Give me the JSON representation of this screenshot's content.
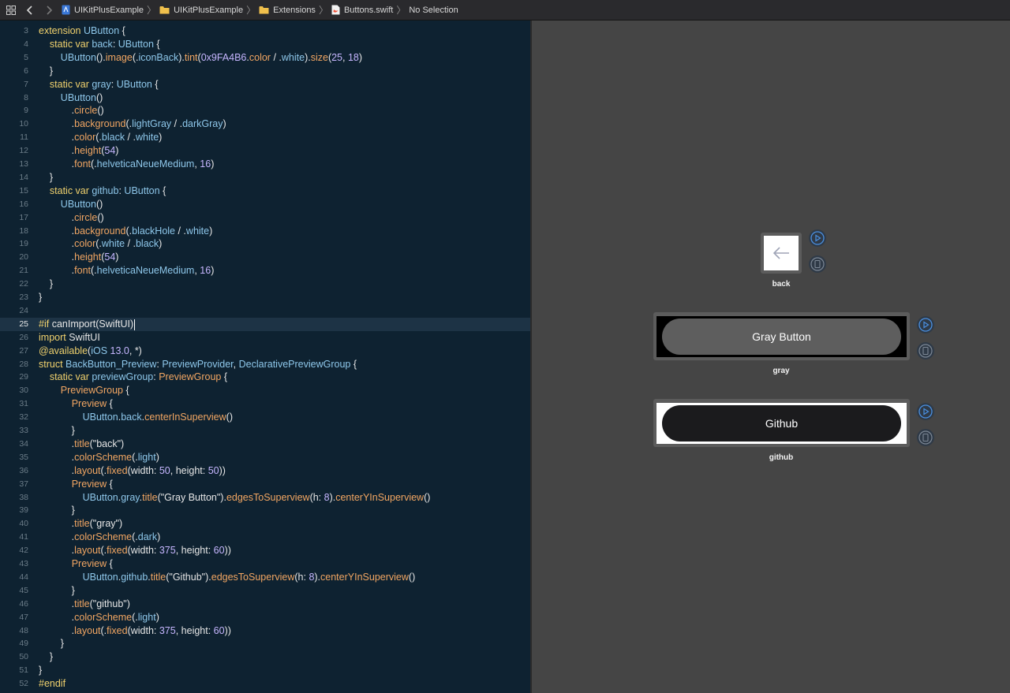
{
  "breadcrumb": {
    "items": [
      {
        "label": "UIKitPlusExample",
        "icon": "project-file-icon"
      },
      {
        "label": "UIKitPlusExample",
        "icon": "folder-icon"
      },
      {
        "label": "Extensions",
        "icon": "folder-icon"
      },
      {
        "label": "Buttons.swift",
        "icon": "swift-file-icon"
      },
      {
        "label": "No Selection",
        "icon": ""
      }
    ]
  },
  "editor": {
    "current_line": 25,
    "lines": [
      {
        "n": "3",
        "tokens": [
          [
            "kw",
            "extension "
          ],
          [
            "ty",
            "UButton"
          ],
          [
            "pl",
            " {"
          ]
        ]
      },
      {
        "n": "4",
        "tokens": [
          [
            "pl",
            "    "
          ],
          [
            "kw",
            "static var "
          ],
          [
            "ty",
            "back"
          ],
          [
            "pl",
            ": "
          ],
          [
            "ty",
            "UButton"
          ],
          [
            "pl",
            " {"
          ]
        ]
      },
      {
        "n": "5",
        "tokens": [
          [
            "pl",
            "        "
          ],
          [
            "ty",
            "UButton"
          ],
          [
            "pl",
            "()."
          ],
          [
            "fn",
            "image"
          ],
          [
            "pl",
            "(."
          ],
          [
            "ty",
            "iconBack"
          ],
          [
            "pl",
            ")."
          ],
          [
            "fn",
            "tint"
          ],
          [
            "pl",
            "("
          ],
          [
            "nm",
            "0x9FA4B6"
          ],
          [
            "pl",
            "."
          ],
          [
            "fn",
            "color"
          ],
          [
            "pl",
            " / ."
          ],
          [
            "ty",
            "white"
          ],
          [
            "pl",
            ")."
          ],
          [
            "fn",
            "size"
          ],
          [
            "pl",
            "("
          ],
          [
            "nm",
            "25"
          ],
          [
            "pl",
            ", "
          ],
          [
            "nm",
            "18"
          ],
          [
            "pl",
            ")"
          ]
        ]
      },
      {
        "n": "6",
        "tokens": [
          [
            "pl",
            "    }"
          ]
        ]
      },
      {
        "n": "7",
        "tokens": [
          [
            "pl",
            "    "
          ],
          [
            "kw",
            "static var "
          ],
          [
            "ty",
            "gray"
          ],
          [
            "pl",
            ": "
          ],
          [
            "ty",
            "UButton"
          ],
          [
            "pl",
            " {"
          ]
        ]
      },
      {
        "n": "8",
        "tokens": [
          [
            "pl",
            "        "
          ],
          [
            "ty",
            "UButton"
          ],
          [
            "pl",
            "()"
          ]
        ]
      },
      {
        "n": "9",
        "tokens": [
          [
            "pl",
            "            ."
          ],
          [
            "fn",
            "circle"
          ],
          [
            "pl",
            "()"
          ]
        ]
      },
      {
        "n": "10",
        "tokens": [
          [
            "pl",
            "            ."
          ],
          [
            "fn",
            "background"
          ],
          [
            "pl",
            "(."
          ],
          [
            "ty",
            "lightGray"
          ],
          [
            "pl",
            " / ."
          ],
          [
            "ty",
            "darkGray"
          ],
          [
            "pl",
            ")"
          ]
        ]
      },
      {
        "n": "11",
        "tokens": [
          [
            "pl",
            "            ."
          ],
          [
            "fn",
            "color"
          ],
          [
            "pl",
            "(."
          ],
          [
            "ty",
            "black"
          ],
          [
            "pl",
            " / ."
          ],
          [
            "ty",
            "white"
          ],
          [
            "pl",
            ")"
          ]
        ]
      },
      {
        "n": "12",
        "tokens": [
          [
            "pl",
            "            ."
          ],
          [
            "fn",
            "height"
          ],
          [
            "pl",
            "("
          ],
          [
            "nm",
            "54"
          ],
          [
            "pl",
            ")"
          ]
        ]
      },
      {
        "n": "13",
        "tokens": [
          [
            "pl",
            "            ."
          ],
          [
            "fn",
            "font"
          ],
          [
            "pl",
            "(."
          ],
          [
            "ty",
            "helveticaNeueMedium"
          ],
          [
            "pl",
            ", "
          ],
          [
            "nm",
            "16"
          ],
          [
            "pl",
            ")"
          ]
        ]
      },
      {
        "n": "14",
        "tokens": [
          [
            "pl",
            "    }"
          ]
        ]
      },
      {
        "n": "15",
        "tokens": [
          [
            "pl",
            "    "
          ],
          [
            "kw",
            "static var "
          ],
          [
            "ty",
            "github"
          ],
          [
            "pl",
            ": "
          ],
          [
            "ty",
            "UButton"
          ],
          [
            "pl",
            " {"
          ]
        ]
      },
      {
        "n": "16",
        "tokens": [
          [
            "pl",
            "        "
          ],
          [
            "ty",
            "UButton"
          ],
          [
            "pl",
            "()"
          ]
        ]
      },
      {
        "n": "17",
        "tokens": [
          [
            "pl",
            "            ."
          ],
          [
            "fn",
            "circle"
          ],
          [
            "pl",
            "()"
          ]
        ]
      },
      {
        "n": "18",
        "tokens": [
          [
            "pl",
            "            ."
          ],
          [
            "fn",
            "background"
          ],
          [
            "pl",
            "(."
          ],
          [
            "ty",
            "blackHole"
          ],
          [
            "pl",
            " / ."
          ],
          [
            "ty",
            "white"
          ],
          [
            "pl",
            ")"
          ]
        ]
      },
      {
        "n": "19",
        "tokens": [
          [
            "pl",
            "            ."
          ],
          [
            "fn",
            "color"
          ],
          [
            "pl",
            "(."
          ],
          [
            "ty",
            "white"
          ],
          [
            "pl",
            " / ."
          ],
          [
            "ty",
            "black"
          ],
          [
            "pl",
            ")"
          ]
        ]
      },
      {
        "n": "20",
        "tokens": [
          [
            "pl",
            "            ."
          ],
          [
            "fn",
            "height"
          ],
          [
            "pl",
            "("
          ],
          [
            "nm",
            "54"
          ],
          [
            "pl",
            ")"
          ]
        ]
      },
      {
        "n": "21",
        "tokens": [
          [
            "pl",
            "            ."
          ],
          [
            "fn",
            "font"
          ],
          [
            "pl",
            "(."
          ],
          [
            "ty",
            "helveticaNeueMedium"
          ],
          [
            "pl",
            ", "
          ],
          [
            "nm",
            "16"
          ],
          [
            "pl",
            ")"
          ]
        ]
      },
      {
        "n": "22",
        "tokens": [
          [
            "pl",
            "    }"
          ]
        ]
      },
      {
        "n": "23",
        "tokens": [
          [
            "pl",
            "}"
          ]
        ]
      },
      {
        "n": "24",
        "tokens": []
      },
      {
        "n": "25",
        "tokens": [
          [
            "pre",
            "#if "
          ],
          [
            "pl",
            "canImport(SwiftUI)"
          ]
        ]
      },
      {
        "n": "26",
        "tokens": [
          [
            "kw",
            "import "
          ],
          [
            "pl",
            "SwiftUI"
          ]
        ]
      },
      {
        "n": "27",
        "tokens": [
          [
            "kw",
            "@available"
          ],
          [
            "pl",
            "("
          ],
          [
            "ty",
            "iOS"
          ],
          [
            "pl",
            " "
          ],
          [
            "nm",
            "13.0"
          ],
          [
            "pl",
            ", *)"
          ]
        ]
      },
      {
        "n": "28",
        "tokens": [
          [
            "kw",
            "struct "
          ],
          [
            "ty",
            "BackButton_Preview"
          ],
          [
            "pl",
            ": "
          ],
          [
            "ty",
            "PreviewProvider"
          ],
          [
            "pl",
            ", "
          ],
          [
            "ty",
            "DeclarativePreviewGroup"
          ],
          [
            "pl",
            " {"
          ]
        ]
      },
      {
        "n": "29",
        "tokens": [
          [
            "pl",
            "    "
          ],
          [
            "kw",
            "static var "
          ],
          [
            "ty",
            "previewGroup"
          ],
          [
            "pl",
            ": "
          ],
          [
            "fn",
            "PreviewGroup"
          ],
          [
            "pl",
            " {"
          ]
        ]
      },
      {
        "n": "30",
        "tokens": [
          [
            "pl",
            "        "
          ],
          [
            "fn",
            "PreviewGroup"
          ],
          [
            "pl",
            " {"
          ]
        ]
      },
      {
        "n": "31",
        "tokens": [
          [
            "pl",
            "            "
          ],
          [
            "fn",
            "Preview"
          ],
          [
            "pl",
            " {"
          ]
        ]
      },
      {
        "n": "32",
        "tokens": [
          [
            "pl",
            "                "
          ],
          [
            "ty",
            "UButton"
          ],
          [
            "pl",
            "."
          ],
          [
            "ty",
            "back"
          ],
          [
            "pl",
            "."
          ],
          [
            "fn",
            "centerInSuperview"
          ],
          [
            "pl",
            "()"
          ]
        ]
      },
      {
        "n": "33",
        "tokens": [
          [
            "pl",
            "            }"
          ]
        ]
      },
      {
        "n": "34",
        "tokens": [
          [
            "pl",
            "            ."
          ],
          [
            "fn",
            "title"
          ],
          [
            "pl",
            "(\"back\")"
          ]
        ]
      },
      {
        "n": "35",
        "tokens": [
          [
            "pl",
            "            ."
          ],
          [
            "fn",
            "colorScheme"
          ],
          [
            "pl",
            "(."
          ],
          [
            "ty",
            "light"
          ],
          [
            "pl",
            ")"
          ]
        ]
      },
      {
        "n": "36",
        "tokens": [
          [
            "pl",
            "            ."
          ],
          [
            "fn",
            "layout"
          ],
          [
            "pl",
            "(."
          ],
          [
            "fn",
            "fixed"
          ],
          [
            "pl",
            "(width: "
          ],
          [
            "nm",
            "50"
          ],
          [
            "pl",
            ", height: "
          ],
          [
            "nm",
            "50"
          ],
          [
            "pl",
            "))"
          ]
        ]
      },
      {
        "n": "37",
        "tokens": [
          [
            "pl",
            "            "
          ],
          [
            "fn",
            "Preview"
          ],
          [
            "pl",
            " {"
          ]
        ]
      },
      {
        "n": "38",
        "tokens": [
          [
            "pl",
            "                "
          ],
          [
            "ty",
            "UButton"
          ],
          [
            "pl",
            "."
          ],
          [
            "ty",
            "gray"
          ],
          [
            "pl",
            "."
          ],
          [
            "fn",
            "title"
          ],
          [
            "pl",
            "(\"Gray Button\")."
          ],
          [
            "fn",
            "edgesToSuperview"
          ],
          [
            "pl",
            "(h: "
          ],
          [
            "nm",
            "8"
          ],
          [
            "pl",
            ")."
          ],
          [
            "fn",
            "centerYInSuperview"
          ],
          [
            "pl",
            "()"
          ]
        ]
      },
      {
        "n": "39",
        "tokens": [
          [
            "pl",
            "            }"
          ]
        ]
      },
      {
        "n": "40",
        "tokens": [
          [
            "pl",
            "            ."
          ],
          [
            "fn",
            "title"
          ],
          [
            "pl",
            "(\"gray\")"
          ]
        ]
      },
      {
        "n": "41",
        "tokens": [
          [
            "pl",
            "            ."
          ],
          [
            "fn",
            "colorScheme"
          ],
          [
            "pl",
            "(."
          ],
          [
            "ty",
            "dark"
          ],
          [
            "pl",
            ")"
          ]
        ]
      },
      {
        "n": "42",
        "tokens": [
          [
            "pl",
            "            ."
          ],
          [
            "fn",
            "layout"
          ],
          [
            "pl",
            "(."
          ],
          [
            "fn",
            "fixed"
          ],
          [
            "pl",
            "(width: "
          ],
          [
            "nm",
            "375"
          ],
          [
            "pl",
            ", height: "
          ],
          [
            "nm",
            "60"
          ],
          [
            "pl",
            "))"
          ]
        ]
      },
      {
        "n": "43",
        "tokens": [
          [
            "pl",
            "            "
          ],
          [
            "fn",
            "Preview"
          ],
          [
            "pl",
            " {"
          ]
        ]
      },
      {
        "n": "44",
        "tokens": [
          [
            "pl",
            "                "
          ],
          [
            "ty",
            "UButton"
          ],
          [
            "pl",
            "."
          ],
          [
            "ty",
            "github"
          ],
          [
            "pl",
            "."
          ],
          [
            "fn",
            "title"
          ],
          [
            "pl",
            "(\"Github\")."
          ],
          [
            "fn",
            "edgesToSuperview"
          ],
          [
            "pl",
            "(h: "
          ],
          [
            "nm",
            "8"
          ],
          [
            "pl",
            ")."
          ],
          [
            "fn",
            "centerYInSuperview"
          ],
          [
            "pl",
            "()"
          ]
        ]
      },
      {
        "n": "45",
        "tokens": [
          [
            "pl",
            "            }"
          ]
        ]
      },
      {
        "n": "46",
        "tokens": [
          [
            "pl",
            "            ."
          ],
          [
            "fn",
            "title"
          ],
          [
            "pl",
            "(\"github\")"
          ]
        ]
      },
      {
        "n": "47",
        "tokens": [
          [
            "pl",
            "            ."
          ],
          [
            "fn",
            "colorScheme"
          ],
          [
            "pl",
            "(."
          ],
          [
            "ty",
            "light"
          ],
          [
            "pl",
            ")"
          ]
        ]
      },
      {
        "n": "48",
        "tokens": [
          [
            "pl",
            "            ."
          ],
          [
            "fn",
            "layout"
          ],
          [
            "pl",
            "(."
          ],
          [
            "fn",
            "fixed"
          ],
          [
            "pl",
            "(width: "
          ],
          [
            "nm",
            "375"
          ],
          [
            "pl",
            ", height: "
          ],
          [
            "nm",
            "60"
          ],
          [
            "pl",
            "))"
          ]
        ]
      },
      {
        "n": "49",
        "tokens": [
          [
            "pl",
            "        }"
          ]
        ]
      },
      {
        "n": "50",
        "tokens": [
          [
            "pl",
            "    }"
          ]
        ]
      },
      {
        "n": "51",
        "tokens": [
          [
            "pl",
            "}"
          ]
        ]
      },
      {
        "n": "52",
        "tokens": [
          [
            "pre",
            "#endif"
          ]
        ]
      }
    ]
  },
  "previews": {
    "back": {
      "label": "back"
    },
    "gray": {
      "label": "gray",
      "button_title": "Gray Button"
    },
    "github": {
      "label": "github",
      "button_title": "Github"
    }
  },
  "colors": {
    "editor_bg": "#0e2231",
    "canvas_bg": "#454545",
    "accent_blue": "#4a90e2"
  }
}
